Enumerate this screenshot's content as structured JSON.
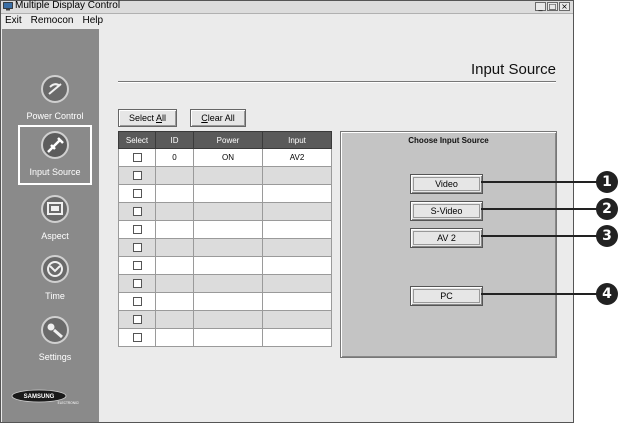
{
  "window": {
    "title": "Multiple Display Control"
  },
  "menu": [
    "Exit",
    "Remocon",
    "Help"
  ],
  "sidebar": {
    "items": [
      {
        "label": "Power Control",
        "icon": "power-control-icon"
      },
      {
        "label": "Input Source",
        "icon": "input-source-icon",
        "selected": true
      },
      {
        "label": "Aspect",
        "icon": "aspect-icon"
      },
      {
        "label": "Time",
        "icon": "time-icon"
      },
      {
        "label": "Settings",
        "icon": "settings-icon"
      }
    ],
    "brand": {
      "name": "SAMSUNG",
      "sub": "ELECTRONICS"
    }
  },
  "page": {
    "title": "Input Source"
  },
  "actions": {
    "select_all": "Select All",
    "select_all_mnemonic": "A",
    "clear_all": "Clear All",
    "clear_all_mnemonic": "C"
  },
  "table": {
    "headers": [
      "Select",
      "ID",
      "Power",
      "Input"
    ],
    "rows": [
      {
        "id": "0",
        "power": "ON",
        "input": "AV2"
      },
      {
        "id": "",
        "power": "",
        "input": ""
      },
      {
        "id": "",
        "power": "",
        "input": ""
      },
      {
        "id": "",
        "power": "",
        "input": ""
      },
      {
        "id": "",
        "power": "",
        "input": ""
      },
      {
        "id": "",
        "power": "",
        "input": ""
      },
      {
        "id": "",
        "power": "",
        "input": ""
      },
      {
        "id": "",
        "power": "",
        "input": ""
      },
      {
        "id": "",
        "power": "",
        "input": ""
      },
      {
        "id": "",
        "power": "",
        "input": ""
      },
      {
        "id": "",
        "power": "",
        "input": ""
      }
    ]
  },
  "source_panel": {
    "title": "Choose Input Source",
    "buttons": [
      "Video",
      "S-Video",
      "AV 2",
      "PC"
    ]
  },
  "callouts": [
    "1",
    "2",
    "3",
    "4"
  ]
}
